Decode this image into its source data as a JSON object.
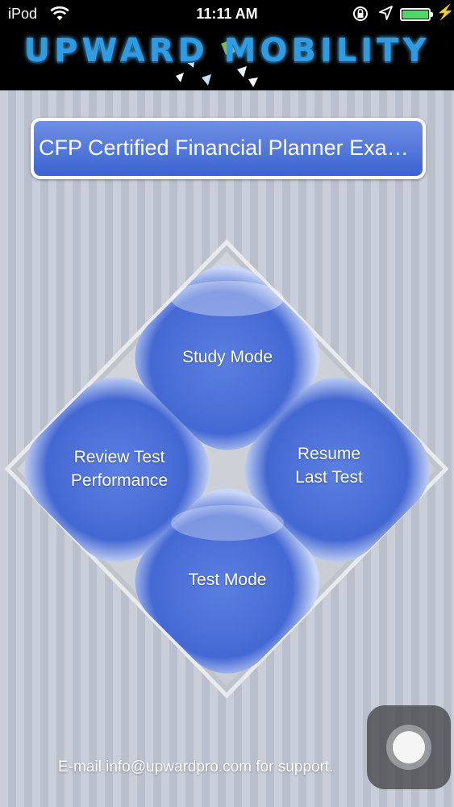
{
  "status_bar": {
    "carrier": "iPod",
    "time": "11:11 AM",
    "wifi_icon": "wifi-icon",
    "lock_icon": "orientation-lock-icon",
    "location_icon": "location-arrow-icon",
    "battery_icon": "battery-icon",
    "charging_icon": "charging-bolt-icon"
  },
  "header": {
    "logo_text": "UPWARD MOBILITY"
  },
  "title_banner": {
    "label": "CFP Certified Financial Planner Exa…"
  },
  "menu": {
    "study_mode": "Study Mode",
    "review_line1": "Review Test",
    "review_line2": "Performance",
    "resume_line1": "Resume",
    "resume_line2": "Last Test",
    "test_mode": "Test Mode"
  },
  "footer": {
    "support_text": "E-mail info@upwardpro.com for support."
  },
  "colors": {
    "button_blue": "#4a6fd6",
    "button_blue_light": "#7f9bea",
    "header_black": "#000000",
    "logo_blue": "#2e9be3",
    "battery_green": "#4cd964"
  }
}
